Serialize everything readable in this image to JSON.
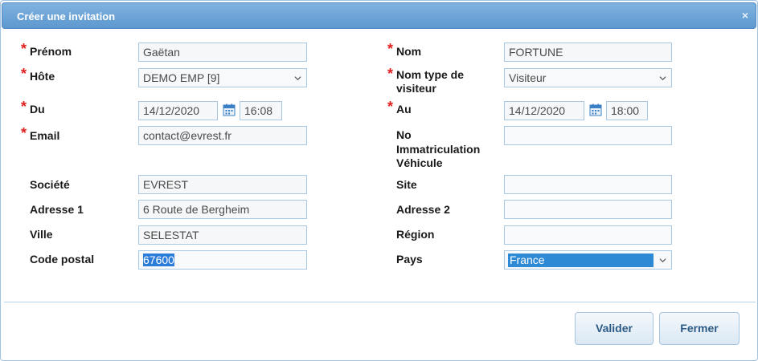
{
  "dialog": {
    "title": "Créer une invitation",
    "close_icon": "×"
  },
  "fields": {
    "prenom": {
      "label": "Prénom",
      "value": "Gaëtan"
    },
    "nom": {
      "label": "Nom",
      "value": "FORTUNE"
    },
    "hote": {
      "label": "Hôte",
      "value": "DEMO EMP [9]"
    },
    "nom_type_visiteur": {
      "label_line1": "Nom type de",
      "label_line2": "visiteur",
      "value": "Visiteur"
    },
    "du": {
      "label": "Du",
      "date": "14/12/2020",
      "time": "16:08"
    },
    "au": {
      "label": "Au",
      "date": "14/12/2020",
      "time": "18:00"
    },
    "email": {
      "label": "Email",
      "value": "contact@evrest.fr"
    },
    "immatriculation": {
      "label_line1": "No",
      "label_line2": "Immatriculation",
      "label_line3": "Véhicule",
      "value": ""
    },
    "societe": {
      "label": "Société",
      "value": "EVREST"
    },
    "site": {
      "label": "Site",
      "value": ""
    },
    "adresse1": {
      "label": "Adresse 1",
      "value": "6 Route de Bergheim"
    },
    "adresse2": {
      "label": "Adresse 2",
      "value": ""
    },
    "ville": {
      "label": "Ville",
      "value": "SELESTAT"
    },
    "region": {
      "label": "Région",
      "value": ""
    },
    "code_postal": {
      "label": "Code postal",
      "value": "67600"
    },
    "pays": {
      "label": "Pays",
      "value": "France"
    }
  },
  "required_marker": "*",
  "buttons": {
    "valider": "Valider",
    "fermer": "Fermer"
  },
  "colors": {
    "titlebar": "#6ea6d8",
    "required": "#e0201f",
    "selection": "#2f8ad6",
    "border": "#a8c8e4"
  }
}
